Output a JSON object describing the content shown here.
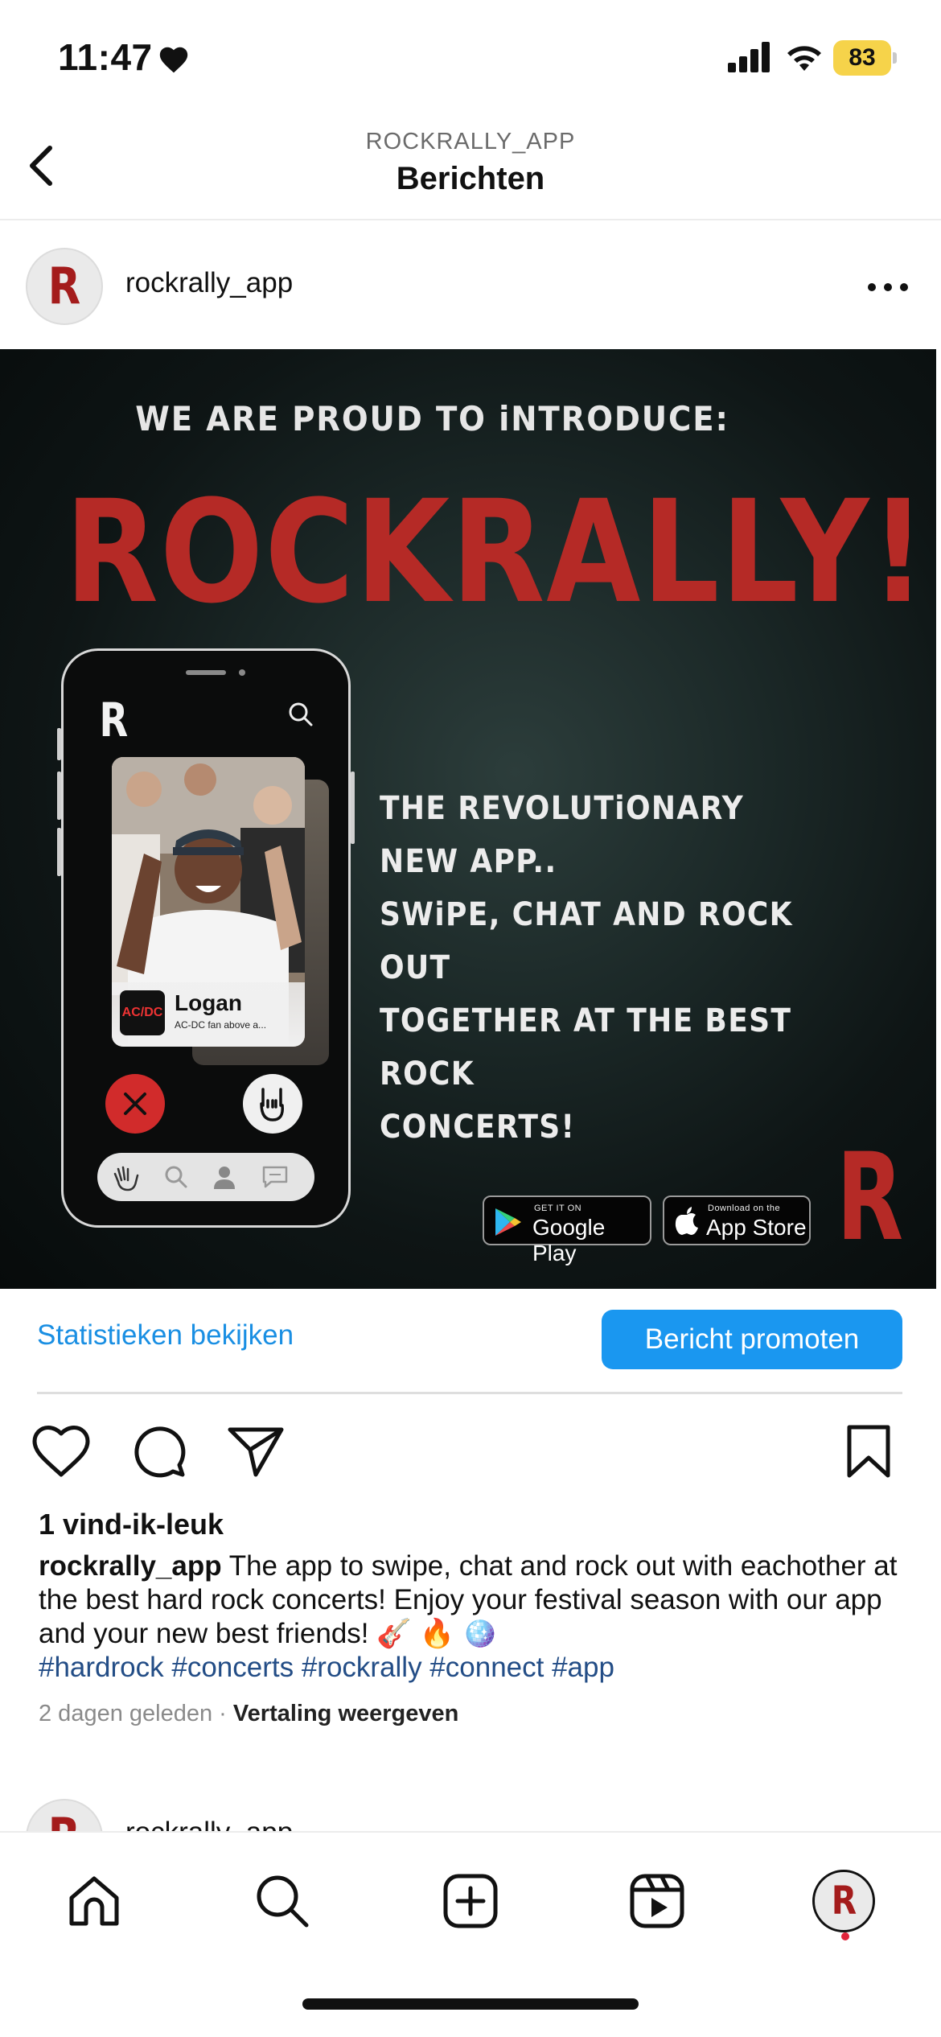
{
  "status_bar": {
    "time": "11:47",
    "battery": "83",
    "battery_color": "#f6d34a"
  },
  "nav": {
    "subtitle": "ROCKRALLY_APP",
    "title": "Berichten"
  },
  "post": {
    "username": "rockrally_app",
    "avatar_letter": "R",
    "image": {
      "intro": "WE ARE PROUD TO iNTRODUCE:",
      "title": "ROCKRALLY!",
      "text_lines": [
        "THE REVOLUTiONARY NEW APP..",
        "SWiPE, CHAT AND ROCK OUT",
        "TOGETHER AT THE BEST ROCK",
        "CONCERTS!"
      ],
      "phone": {
        "logo": "R",
        "card_name": "Logan",
        "card_description": "AC-DC fan above a...",
        "card_badge": "AC/DC"
      },
      "google_play": {
        "small": "GET IT ON",
        "big": "Google Play"
      },
      "app_store": {
        "small": "Download on the",
        "big": "App Store"
      },
      "corner_logo": "R"
    },
    "stats_link": "Statistieken bekijken",
    "promote_button": "Bericht promoten",
    "likes": "1 vind-ik-leuk",
    "caption_user": "rockrally_app",
    "caption_text": " The app to swipe, chat and rock out with eachother at the best hard rock concerts! Enjoy your festival season with our app and your new best friends! 🎸 🔥 🪩",
    "hashtags": "#hardrock #concerts #rockrally #connect #app",
    "time_ago": "2 dagen geleden",
    "separator": "·",
    "translate": "Vertaling weergeven"
  },
  "next_post": {
    "username": "rockrally_app",
    "avatar_letter": "R"
  },
  "tab_bar": {
    "profile_letter": "R"
  },
  "colors": {
    "accent_blue": "#1a97f0",
    "link_blue": "#1a8fe3",
    "hashtag_blue": "#234d86",
    "brand_red": "#b52a26"
  }
}
